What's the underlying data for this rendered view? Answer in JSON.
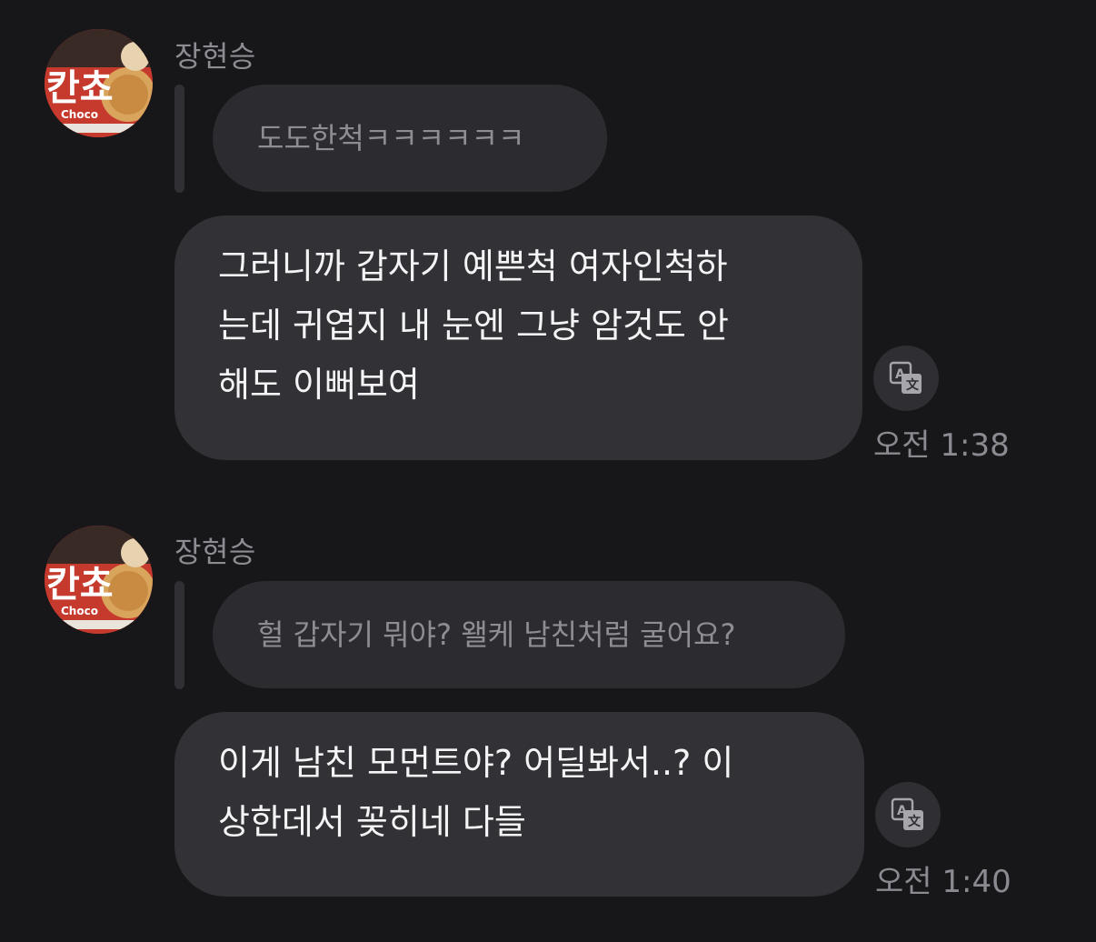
{
  "messages": [
    {
      "sender": "장현승",
      "avatar_icon": "choco-snack-avatar-icon",
      "avatar_label": "Choco",
      "reply_to": "도도한척ㅋㅋㅋㅋㅋㅋ",
      "lines": [
        "그러니까 갑자기 예쁜척 여자인척하",
        "는데 귀엽지 내 눈엔 그냥 암것도 안",
        "해도 이뻐보여"
      ],
      "time": "오전 1:38",
      "translate_icon": "translate-icon"
    },
    {
      "sender": "장현승",
      "avatar_icon": "choco-snack-avatar-icon",
      "avatar_label": "Choco",
      "reply_to": "헐 갑자기 뭐야? 왤케 남친처럼 굴어요?",
      "lines": [
        "이게 남친 모먼트야? 어딜봐서..? 이",
        "상한데서 꽂히네 다들"
      ],
      "time": "오전 1:40",
      "translate_icon": "translate-icon"
    }
  ],
  "colors": {
    "background": "#17171a",
    "bubble": "#323236",
    "reply_bubble": "#2c2c30",
    "secondary_text": "#8c8c92"
  }
}
